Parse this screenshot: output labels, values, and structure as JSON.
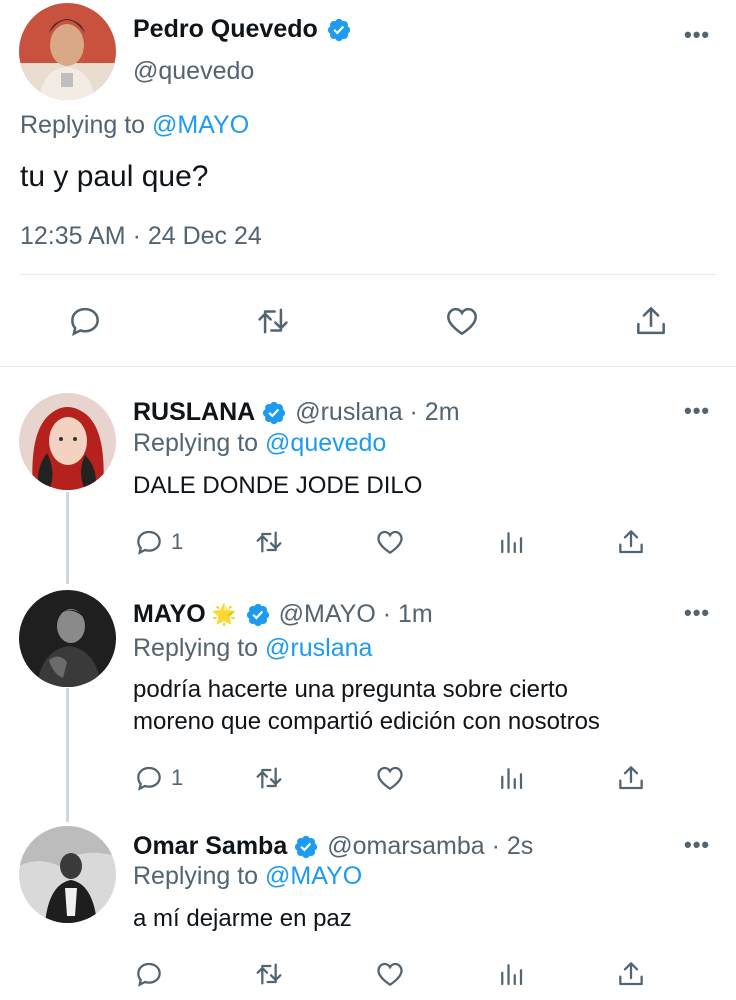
{
  "main": {
    "name": "Pedro Quevedo",
    "handle": "@quevedo",
    "replying_prefix": "Replying to",
    "replying_to": "@MAYO",
    "text": "tu y paul que?",
    "timestamp": "12:35 AM · 24 Dec 24",
    "more_label": "•••"
  },
  "replies": [
    {
      "name": "RUSLANA",
      "handle": "@ruslana · 2m",
      "replying_prefix": "Replying to",
      "replying_to": "@quevedo",
      "text_lines": [
        "DALE DONDE JODE DILO"
      ],
      "reply_count": "1",
      "more_label": "•••"
    },
    {
      "name": "MAYO",
      "emoji": "🌟",
      "handle": "@MAYO · 1m",
      "replying_prefix": "Replying to",
      "replying_to": "@ruslana",
      "text_lines": [
        "podría hacerte una pregunta sobre cierto",
        "moreno que compartió edición con nosotros"
      ],
      "reply_count": "1",
      "more_label": "•••"
    },
    {
      "name": "Omar Samba",
      "handle": "@omarsamba · 2s",
      "replying_prefix": "Replying to",
      "replying_to": "@MAYO",
      "text_lines": [
        "a mí dejarme en paz"
      ],
      "reply_count": "",
      "more_label": "•••"
    }
  ],
  "colors": {
    "verified": "#1d9bf0",
    "link": "#1d9bf0",
    "secondary_text": "#536471"
  },
  "icons": [
    "verified-badge-icon",
    "reply-icon",
    "retweet-icon",
    "like-icon",
    "analytics-icon",
    "share-icon",
    "more-icon"
  ]
}
